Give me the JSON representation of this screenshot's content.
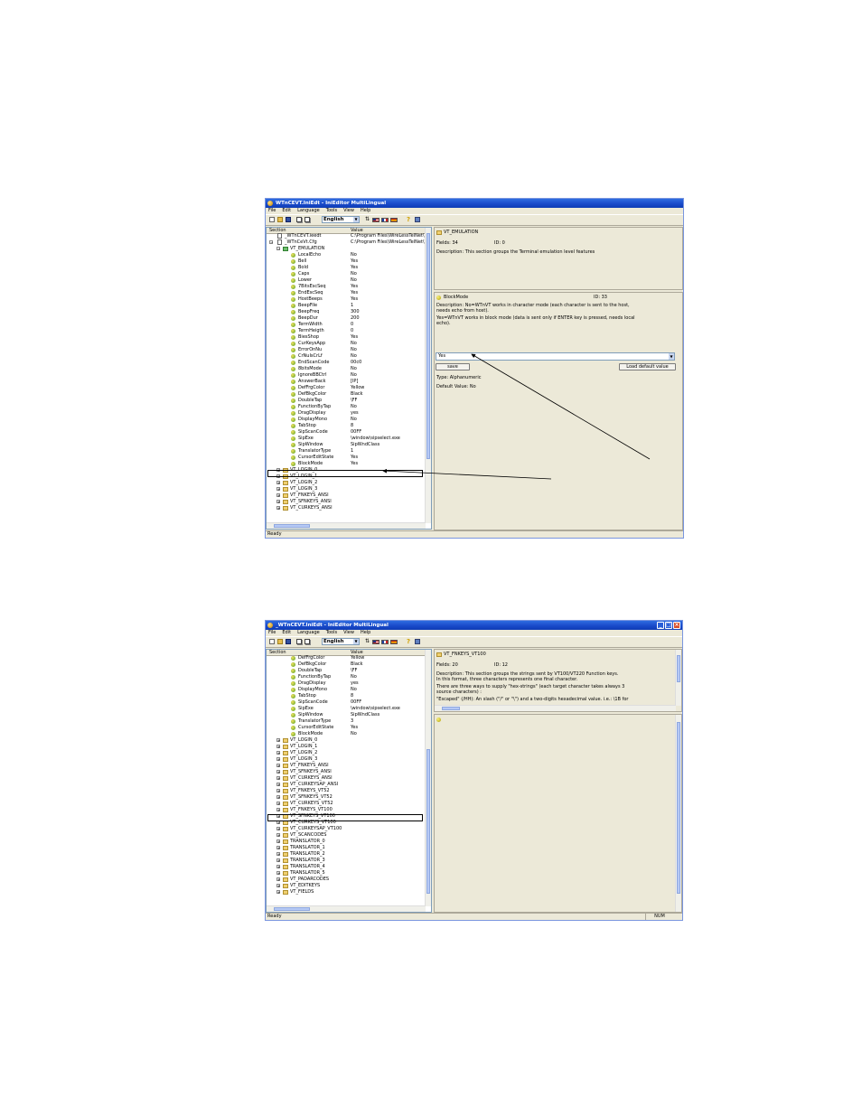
{
  "window1": {
    "title": "WTnCEVT.IniEdt - IniEditor MultiLingual",
    "menu": [
      "File",
      "Edit",
      "Language",
      "Tools",
      "View",
      "Help"
    ],
    "language": "English",
    "tree": {
      "columns": {
        "section": "Section",
        "value": "Value"
      },
      "top_items": [
        {
          "label": "_WTnCEVT.ieedt",
          "value": "C:\\Program Files\\WireLessTelNet\\WTn"
        },
        {
          "label": "_WTnCeVt.Cfg",
          "value": "C:\\Program Files\\WireLessTelNet\\WTn"
        },
        {
          "label": "VT_EMULATION",
          "value": ""
        }
      ],
      "keys": [
        {
          "label": "LocalEcho",
          "value": "No"
        },
        {
          "label": "Bell",
          "value": "Yes"
        },
        {
          "label": "Bold",
          "value": "Yes"
        },
        {
          "label": "Caps",
          "value": "No"
        },
        {
          "label": "Lower",
          "value": "No"
        },
        {
          "label": "7BitsEscSeq",
          "value": "Yes"
        },
        {
          "label": "EndEscSeq",
          "value": "Yes"
        },
        {
          "label": "HostBeeps",
          "value": "Yes"
        },
        {
          "label": "BeepFile",
          "value": "1"
        },
        {
          "label": "BeepFreq",
          "value": "300"
        },
        {
          "label": "BeepDur",
          "value": "200"
        },
        {
          "label": "TermWidth",
          "value": "0"
        },
        {
          "label": "TermHeigth",
          "value": "0"
        },
        {
          "label": "BiesShop",
          "value": "Yes"
        },
        {
          "label": "CurKeysApp",
          "value": "No"
        },
        {
          "label": "ErrorOnNu",
          "value": "No"
        },
        {
          "label": "CrNuIsCrLf",
          "value": "No"
        },
        {
          "label": "EndScanCode",
          "value": "00c0"
        },
        {
          "label": "8bitsMode",
          "value": "No"
        },
        {
          "label": "IgnoreBBCtrl",
          "value": "No"
        },
        {
          "label": "AnswerBack",
          "value": "[IP]"
        },
        {
          "label": "DefFrgColor",
          "value": "Yellow"
        },
        {
          "label": "DefBkgColor",
          "value": "Black"
        },
        {
          "label": "DoubleTap",
          "value": "\\FF"
        },
        {
          "label": "FunctionByTap",
          "value": "No"
        },
        {
          "label": "DragDisplay",
          "value": "yes"
        },
        {
          "label": "DisplayMono",
          "value": "No"
        },
        {
          "label": "TabStop",
          "value": "8"
        },
        {
          "label": "SipScanCode",
          "value": "00FF"
        },
        {
          "label": "SipExe",
          "value": "\\window\\sipselect.exe"
        },
        {
          "label": "SipWindow",
          "value": "SipWndClass"
        },
        {
          "label": "TranslatorType",
          "value": "1"
        },
        {
          "label": "CursorEditState",
          "value": "Yes"
        },
        {
          "label": "BlockMode",
          "value": "Yes"
        }
      ],
      "sections": [
        "VT_LOGIN_0",
        "VT_LOGIN_1",
        "VT_LOGIN_2",
        "VT_LOGIN_3",
        "VT_FNKEYS_ANSI",
        "VT_SFNKEYS_ANSI",
        "VT_CURKEYS_ANSI"
      ]
    },
    "section_info": {
      "name": "VT_EMULATION",
      "fields": "Fields: 34",
      "id": "ID: 0",
      "description": "Description: This section groups the Terminal emulation level features"
    },
    "key_info": {
      "name": "BlockMode",
      "id": "ID: 33",
      "description_lines": [
        "Description: No=WTnVT works in character mode (each character is sent to the host,",
        "needs echo from host).",
        "Yes=WTnVT works in block mode (data is sent only if ENTER key is pressed, needs local",
        "echo)."
      ],
      "value": "Yes",
      "save_label": "save",
      "load_default_label": "Load default value",
      "type": "Type: Alphanumeric",
      "default_value": "Default Value: No"
    },
    "status": "Ready"
  },
  "window2": {
    "title": "_WTnCEVT.IniEdt - IniEditor MultiLingual",
    "menu": [
      "File",
      "Edit",
      "Language",
      "Tools",
      "View",
      "Help"
    ],
    "language": "English",
    "tree": {
      "columns": {
        "section": "Section",
        "value": "Value"
      },
      "keys": [
        {
          "label": "DefFrgColor",
          "value": "Yellow"
        },
        {
          "label": "DefBkgColor",
          "value": "Black"
        },
        {
          "label": "DoubleTap",
          "value": "\\FF"
        },
        {
          "label": "FunctionByTap",
          "value": "No"
        },
        {
          "label": "DragDisplay",
          "value": "yes"
        },
        {
          "label": "DisplayMono",
          "value": "No"
        },
        {
          "label": "TabStop",
          "value": "8"
        },
        {
          "label": "SipScanCode",
          "value": "00FF"
        },
        {
          "label": "SipExe",
          "value": "\\window\\sipselect.exe"
        },
        {
          "label": "SipWindow",
          "value": "SipWndClass"
        },
        {
          "label": "TranslatorType",
          "value": "3"
        },
        {
          "label": "CursorEditState",
          "value": "Yes"
        },
        {
          "label": "BlockMode",
          "value": "No"
        }
      ],
      "sections": [
        "VT_LOGIN_0",
        "VT_LOGIN_1",
        "VT_LOGIN_2",
        "VT_LOGIN_3",
        "VT_FNKEYS_ANSI",
        "VT_SFNKEYS_ANSI",
        "VT_CURKEYS_ANSI",
        "VT_CURKEYSAP_ANSI",
        "VT_FNKEYS_VT52",
        "VT_SFNKEYS_VT52",
        "VT_CURKEYS_VT52",
        "VT_FNKEYS_VT100",
        "VT_SFNKEYS_VT100",
        "VT_CURKEYS_VT100",
        "VT_CURKEYSAP_VT100",
        "VT_SCANCODES",
        "TRANSLATOR_0",
        "TRANSLATOR_1",
        "TRANSLATOR_2",
        "TRANSLATOR_3",
        "TRANSLATOR_4",
        "TRANSLATOR_5",
        "VT_PADARCODES",
        "VT_EDITKEYS",
        "VT_FIELDS"
      ]
    },
    "section_info": {
      "name": "VT_FNKEYS_VT100",
      "fields": "Fields: 20",
      "id": "ID: 12",
      "description_lines": [
        "Description: This section groups the strings sent by VT100/VT220 Function keys.",
        "In this format, three characters represents one final character.",
        "There are three ways to supply \"hex-strings\" (each target character takes always 3",
        "source characters) :",
        "\"Escaped\" (/HH): An slash (\"/\" or \"\\\") and a two-digits hexadecimal value. i.e.: \\1B for"
      ]
    },
    "status": "Ready",
    "num_indicator": "NUM"
  }
}
